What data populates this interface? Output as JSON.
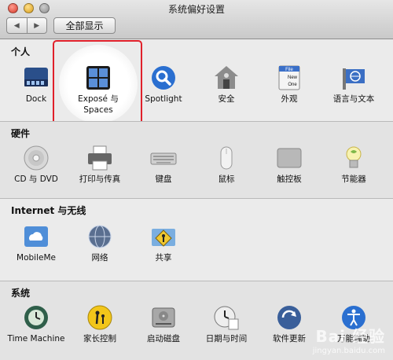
{
  "window": {
    "title": "系统偏好设置"
  },
  "toolbar": {
    "back_label": "◀",
    "forward_label": "▶",
    "show_all_label": "全部显示"
  },
  "sections": {
    "personal": {
      "title": "个人",
      "items": [
        {
          "label": "Dock",
          "icon": "dock-icon"
        },
        {
          "label": "Exposé 与\nSpaces",
          "icon": "expose-spaces-icon"
        },
        {
          "label": "Spotlight",
          "icon": "spotlight-icon"
        },
        {
          "label": "安全",
          "icon": "security-icon"
        },
        {
          "label": "外观",
          "icon": "appearance-icon"
        },
        {
          "label": "语言与文本",
          "icon": "language-icon"
        }
      ]
    },
    "hardware": {
      "title": "硬件",
      "items": [
        {
          "label": "CD 与 DVD",
          "icon": "cd-dvd-icon"
        },
        {
          "label": "打印与传真",
          "icon": "printer-icon"
        },
        {
          "label": "键盘",
          "icon": "keyboard-icon"
        },
        {
          "label": "鼠标",
          "icon": "mouse-icon"
        },
        {
          "label": "触控板",
          "icon": "trackpad-icon"
        },
        {
          "label": "节能器",
          "icon": "energy-saver-icon"
        }
      ]
    },
    "internet": {
      "title": "Internet 与无线",
      "items": [
        {
          "label": "MobileMe",
          "icon": "mobileme-icon"
        },
        {
          "label": "网络",
          "icon": "network-icon"
        },
        {
          "label": "共享",
          "icon": "sharing-icon"
        }
      ]
    },
    "system": {
      "title": "系统",
      "items": [
        {
          "label": "Time Machine",
          "icon": "time-machine-icon"
        },
        {
          "label": "家长控制",
          "icon": "parental-controls-icon"
        },
        {
          "label": "启动磁盘",
          "icon": "startup-disk-icon"
        },
        {
          "label": "日期与时间",
          "icon": "date-time-icon"
        },
        {
          "label": "软件更新",
          "icon": "software-update-icon"
        },
        {
          "label": "万能辅助",
          "icon": "universal-access-icon"
        }
      ]
    }
  },
  "appearance_icon_text": {
    "line1": "File",
    "line2": "New",
    "line3": "One"
  },
  "watermark": {
    "main": "Bai 经验",
    "sub": "jingyan.baidu.com"
  },
  "colors": {
    "highlight": "#e0202a",
    "accent_blue": "#2a6fd0"
  }
}
